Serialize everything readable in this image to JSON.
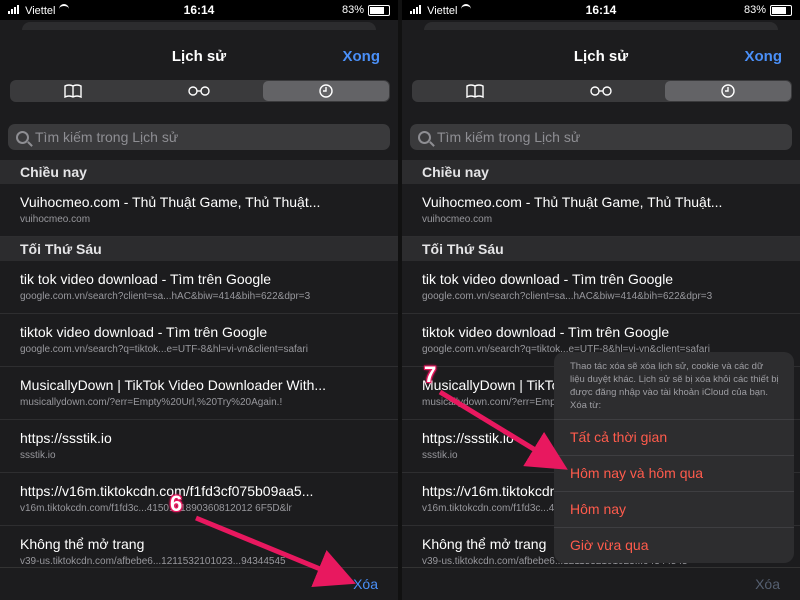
{
  "status": {
    "carrier": "Viettel",
    "time": "16:14",
    "battery": "83%"
  },
  "nav": {
    "title": "Lịch sử",
    "done": "Xong"
  },
  "tabs": [
    "bookmarks-icon",
    "reading-list-icon",
    "history-icon"
  ],
  "search": {
    "placeholder": "Tìm kiếm trong Lịch sử"
  },
  "sections": [
    {
      "title": "Chiều nay",
      "items": [
        {
          "title": "Vuihocmeo.com - Thủ Thuật Game, Thủ Thuật...",
          "url": "vuihocmeo.com"
        }
      ]
    },
    {
      "title": "Tối Thứ Sáu",
      "items": [
        {
          "title": "tik tok video download - Tìm trên Google",
          "url": "google.com.vn/search?client=sa...hAC&biw=414&bih=622&dpr=3"
        },
        {
          "title": "tiktok video download - Tìm trên Google",
          "url": "google.com.vn/search?q=tiktok...e=UTF-8&hl=vi-vn&client=safari"
        },
        {
          "title": "MusicallyDown | TikTok Video Downloader With...",
          "url": "musicallydown.com/?err=Empty%20Url,%20Try%20Again.!"
        },
        {
          "title": "https://ssstik.io",
          "url": "ssstik.io"
        },
        {
          "title": "https://v16m.tiktokcdn.com/f1fd3cf075b09aa5...",
          "url": "v16m.tiktokcdn.com/f1fd3c...4150101890360812012 6F5D&lr"
        },
        {
          "title": "Không thể mở trang",
          "url": "v39-us.tiktokcdn.com/afbebe6...1211532101023...94344545"
        }
      ]
    }
  ],
  "toolbar": {
    "clear": "Xóa"
  },
  "popover": {
    "message": "Thao tác xóa sẽ xóa lịch sử, cookie và các dữ liệu duyệt khác. Lịch sử sẽ bị xóa khỏi các thiết bị được đăng nhập vào tài khoản iCloud của bạn. Xóa từ:",
    "options": [
      "Tất cả thời gian",
      "Hôm nay và hôm qua",
      "Hôm nay",
      "Giờ vừa qua"
    ]
  },
  "steps": {
    "left": "6",
    "right": "7"
  },
  "colors": {
    "accent": "#4a8ff7",
    "destructive": "#ff5b4c",
    "annotation": "#e8185f"
  }
}
